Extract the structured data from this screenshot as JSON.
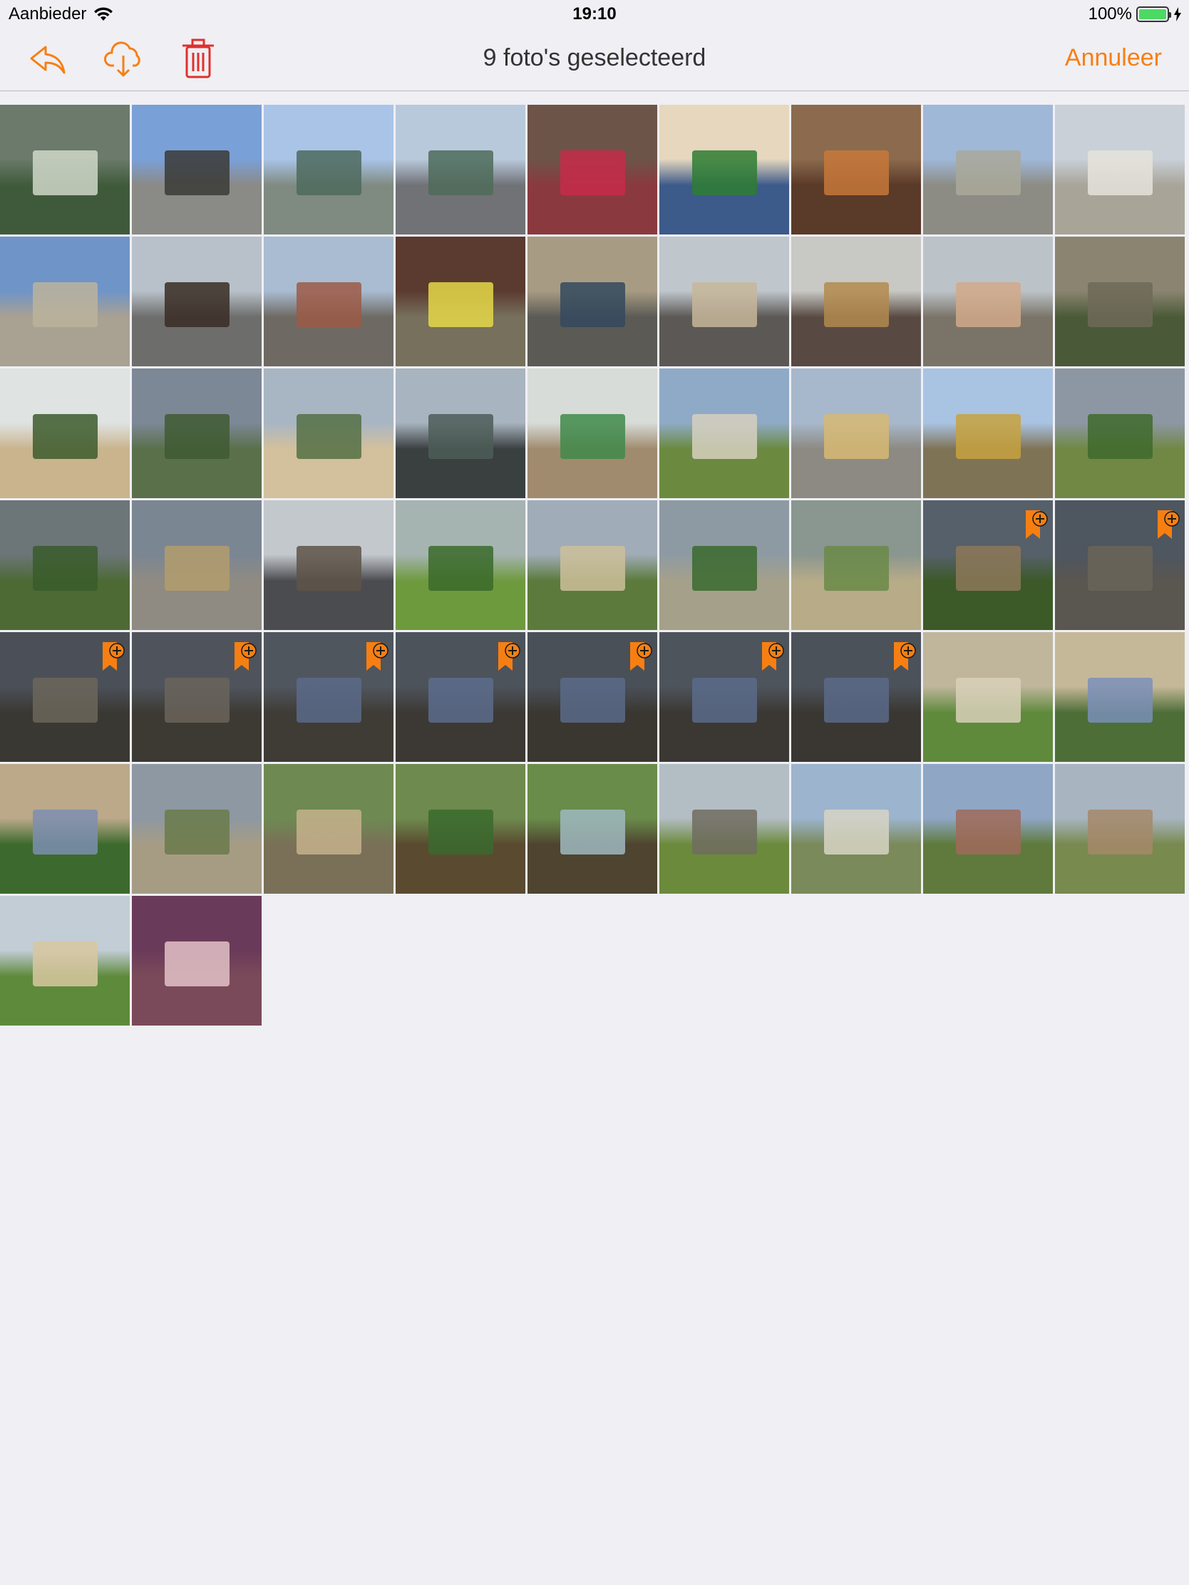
{
  "status_bar": {
    "carrier": "Aanbieder",
    "time": "19:10",
    "battery_percent": "100%",
    "battery_level": 1.0
  },
  "nav": {
    "title": "9 foto's geselecteerd",
    "cancel_label": "Annuleer",
    "accent": "#f77f12",
    "delete_color": "#e0302b"
  },
  "photos": [
    {
      "sky": "#6b7a6a",
      "ground": "#3f5a3a",
      "feature": "#cfd7c8",
      "badge": false
    },
    {
      "sky": "#7aa0d8",
      "ground": "#8a8a86",
      "feature": "#3a3a36",
      "badge": false
    },
    {
      "sky": "#aac4e8",
      "ground": "#7f8a80",
      "feature": "#4d6a5d",
      "badge": false
    },
    {
      "sky": "#b9c9dc",
      "ground": "#707276",
      "feature": "#4e6b59",
      "badge": false
    },
    {
      "sky": "#6d5448",
      "ground": "#8a3a3e",
      "feature": "#c72b4a",
      "badge": false
    },
    {
      "sky": "#e6d7be",
      "ground": "#3c5a8a",
      "feature": "#2e7d32",
      "badge": false
    },
    {
      "sky": "#8b6a4e",
      "ground": "#5a3a28",
      "feature": "#c7783a",
      "badge": false
    },
    {
      "sky": "#9fb8d8",
      "ground": "#8c8c84",
      "feature": "#a9a89a",
      "badge": false
    },
    {
      "sky": "#c9d0d8",
      "ground": "#a8a498",
      "feature": "#e5e3da",
      "badge": false
    },
    {
      "sky": "#6f94c8",
      "ground": "#a9a192",
      "feature": "#bcb39b",
      "badge": false
    },
    {
      "sky": "#b8c1c9",
      "ground": "#6d6d6b",
      "feature": "#3a2d25",
      "badge": false
    },
    {
      "sky": "#a9bcd2",
      "ground": "#6e6962",
      "feature": "#9c5a46",
      "badge": false
    },
    {
      "sky": "#5b3a30",
      "ground": "#77705c",
      "feature": "#e5d848",
      "badge": false
    },
    {
      "sky": "#a79c83",
      "ground": "#5b5a55",
      "feature": "#34495e",
      "badge": false
    },
    {
      "sky": "#bfc6cc",
      "ground": "#5b5855",
      "feature": "#c7b69a",
      "badge": false
    },
    {
      "sky": "#c8c8c4",
      "ground": "#584a42",
      "feature": "#b38a4e",
      "badge": false
    },
    {
      "sky": "#bcc3c8",
      "ground": "#7a7468",
      "feature": "#d1a98a",
      "badge": false
    },
    {
      "sky": "#8b8470",
      "ground": "#4a5a38",
      "feature": "#6e6a58",
      "badge": false
    },
    {
      "sky": "#dfe3e2",
      "ground": "#c9b48d",
      "feature": "#3d5c2e",
      "badge": false
    },
    {
      "sky": "#7d8896",
      "ground": "#59704a",
      "feature": "#3f5a33",
      "badge": false
    },
    {
      "sky": "#a8b6c4",
      "ground": "#d3c09c",
      "feature": "#557045",
      "badge": false
    },
    {
      "sky": "#a8b4c0",
      "ground": "#3a3f3f",
      "feature": "#4d5d58",
      "badge": false
    },
    {
      "sky": "#d7dcd8",
      "ground": "#a08b6e",
      "feature": "#3f8a4a",
      "badge": false
    },
    {
      "sky": "#8faac7",
      "ground": "#6b8a3f",
      "feature": "#d6d0c0",
      "badge": false
    },
    {
      "sky": "#a8b8cc",
      "ground": "#8c8a82",
      "feature": "#d7b872",
      "badge": false
    },
    {
      "sky": "#a9c3e3",
      "ground": "#7f7356",
      "feature": "#c7a23e",
      "badge": false
    },
    {
      "sky": "#8d97a3",
      "ground": "#708844",
      "feature": "#3e6a2d",
      "badge": false
    },
    {
      "sky": "#6c7578",
      "ground": "#4d6a35",
      "feature": "#3a5c2a",
      "badge": false
    },
    {
      "sky": "#7b8693",
      "ground": "#8f8b82",
      "feature": "#b39c6c",
      "badge": false
    },
    {
      "sky": "#c3c8cc",
      "ground": "#4b4c50",
      "feature": "#5e5448",
      "badge": false
    },
    {
      "sky": "#a5b4b0",
      "ground": "#6e9a3e",
      "feature": "#3a6a2a",
      "badge": false
    },
    {
      "sky": "#a0acb7",
      "ground": "#5c7a3c",
      "feature": "#cdbf9a",
      "badge": false
    },
    {
      "sky": "#8e9aa3",
      "ground": "#a5a08a",
      "feature": "#3a6a2e",
      "badge": false
    },
    {
      "sky": "#8a9690",
      "ground": "#b7ab88",
      "feature": "#6a8a48",
      "badge": false
    },
    {
      "sky": "#56606a",
      "ground": "#3c5a28",
      "feature": "#8c7858",
      "badge": true
    },
    {
      "sky": "#4e5660",
      "ground": "#5a5650",
      "feature": "#6a6458",
      "badge": true
    },
    {
      "sky": "#4b5058",
      "ground": "#3a3832",
      "feature": "#6c665a",
      "badge": true
    },
    {
      "sky": "#4f545c",
      "ground": "#3d3a34",
      "feature": "#6a645a",
      "badge": true
    },
    {
      "sky": "#50565e",
      "ground": "#3f3c36",
      "feature": "#5a6a8a",
      "badge": true
    },
    {
      "sky": "#4d535b",
      "ground": "#3c3934",
      "feature": "#5c6c8c",
      "badge": true
    },
    {
      "sky": "#4a5058",
      "ground": "#3a3731",
      "feature": "#5a6a88",
      "badge": true
    },
    {
      "sky": "#4e545c",
      "ground": "#3b3833",
      "feature": "#5b6b8a",
      "badge": true
    },
    {
      "sky": "#4c525a",
      "ground": "#3a3732",
      "feature": "#5a6a89",
      "badge": true
    },
    {
      "sky": "#bfb69c",
      "ground": "#5f8a3c",
      "feature": "#d8d0b8",
      "badge": false
    },
    {
      "sky": "#c5b898",
      "ground": "#4e6e38",
      "feature": "#7a8fb8",
      "badge": false
    },
    {
      "sky": "#bba98a",
      "ground": "#3c6a2e",
      "feature": "#7d8eb0",
      "badge": false
    },
    {
      "sky": "#8e98a2",
      "ground": "#a69c84",
      "feature": "#6a7a4a",
      "badge": false
    },
    {
      "sky": "#6e8a52",
      "ground": "#7a7058",
      "feature": "#c5b28c",
      "badge": false
    },
    {
      "sky": "#6e8a4e",
      "ground": "#5a4a30",
      "feature": "#3a6a2e",
      "badge": false
    },
    {
      "sky": "#6a8c4a",
      "ground": "#4e4430",
      "feature": "#9fb8c0",
      "badge": false
    },
    {
      "sky": "#b3bdc4",
      "ground": "#6b8a3c",
      "feature": "#706c60",
      "badge": false
    },
    {
      "sky": "#9cb4ce",
      "ground": "#7a8a5a",
      "feature": "#d7d3c4",
      "badge": false
    },
    {
      "sky": "#8fa6c4",
      "ground": "#5f7a3c",
      "feature": "#a06a5a",
      "badge": false
    },
    {
      "sky": "#a8b4c0",
      "ground": "#788a4e",
      "feature": "#a4886a",
      "badge": false
    },
    {
      "sky": "#c3cdd6",
      "ground": "#5e8a3c",
      "feature": "#d8c7a0",
      "badge": false
    },
    {
      "sky": "#6a3a5a",
      "ground": "#7a4a5a",
      "feature": "#e3c2c8",
      "badge": false
    }
  ]
}
